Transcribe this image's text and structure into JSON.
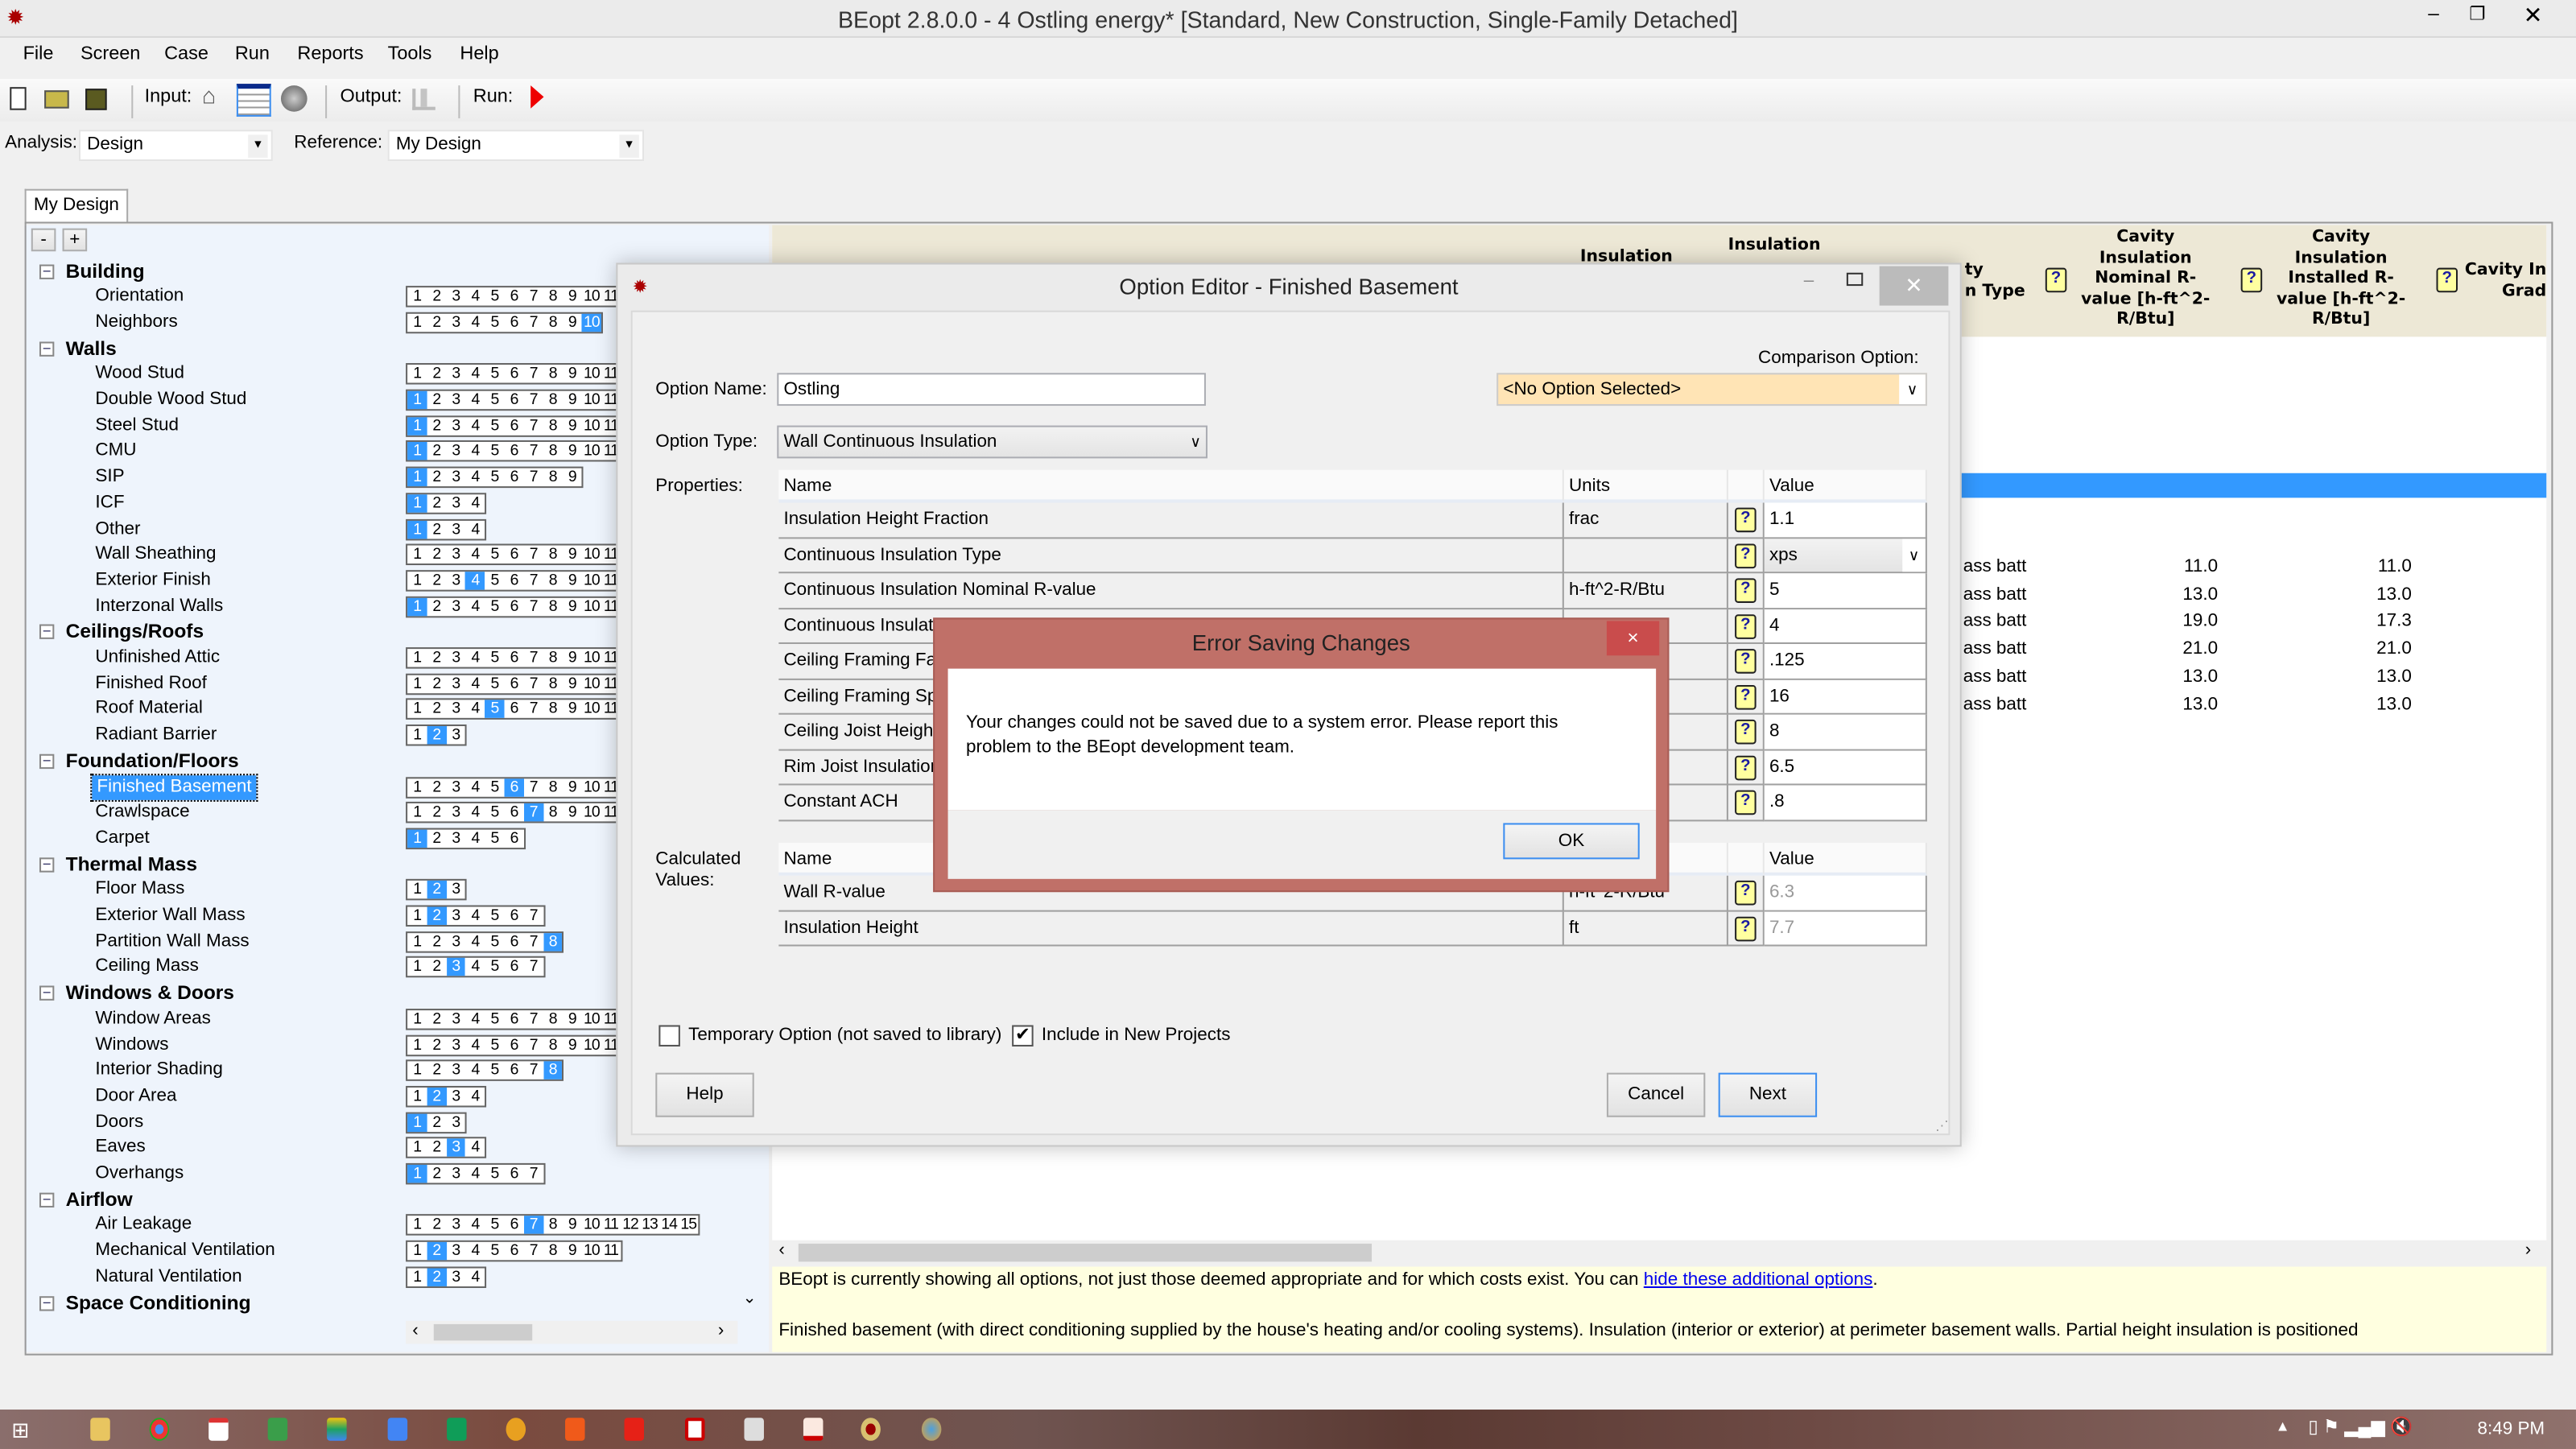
{
  "window": {
    "title": "BEopt 2.8.0.0 - 4 Ostling energy* [Standard, New Construction, Single-Family Detached]",
    "app_icon": "sun-icon"
  },
  "menu": [
    "File",
    "Screen",
    "Case",
    "Run",
    "Reports",
    "Tools",
    "Help"
  ],
  "toolbar": {
    "input_label": "Input:",
    "output_label": "Output:",
    "run_label": "Run:",
    "icons": [
      "new-file-icon",
      "open-folder-icon",
      "save-icon",
      "house-icon",
      "list-icon",
      "globe-icon",
      "chart-icon",
      "run-icon"
    ]
  },
  "analysis": {
    "label": "Analysis:",
    "value": "Design",
    "reference_label": "Reference:",
    "reference_value": "My Design"
  },
  "tab": "My Design",
  "tree": {
    "collapse_label": "-",
    "expand_label": "+",
    "sections": [
      {
        "name": "Building",
        "items": [
          {
            "name": "Orientation",
            "count": 11,
            "selected": null
          },
          {
            "name": "Neighbors",
            "count": 10,
            "selected": 10
          }
        ]
      },
      {
        "name": "Walls",
        "items": [
          {
            "name": "Wood Stud",
            "count": 11,
            "selected": null
          },
          {
            "name": "Double Wood Stud",
            "count": 11,
            "selected": 1
          },
          {
            "name": "Steel Stud",
            "count": 11,
            "selected": 1
          },
          {
            "name": "CMU",
            "count": 11,
            "selected": 1
          },
          {
            "name": "SIP",
            "count": 9,
            "selected": 1
          },
          {
            "name": "ICF",
            "count": 4,
            "selected": 1
          },
          {
            "name": "Other",
            "count": 4,
            "selected": 1
          },
          {
            "name": "Wall Sheathing",
            "count": 11,
            "selected": null
          },
          {
            "name": "Exterior Finish",
            "count": 11,
            "selected": 4
          },
          {
            "name": "Interzonal Walls",
            "count": 11,
            "selected": 1
          }
        ]
      },
      {
        "name": "Ceilings/Roofs",
        "items": [
          {
            "name": "Unfinished Attic",
            "count": 11,
            "selected": null
          },
          {
            "name": "Finished Roof",
            "count": 11,
            "selected": null
          },
          {
            "name": "Roof Material",
            "count": 11,
            "selected": 5
          },
          {
            "name": "Radiant Barrier",
            "count": 3,
            "selected": 2
          }
        ]
      },
      {
        "name": "Foundation/Floors",
        "items": [
          {
            "name": "Finished Basement",
            "count": 11,
            "selected": 6,
            "active": true
          },
          {
            "name": "Crawlspace",
            "count": 11,
            "selected": 7
          },
          {
            "name": "Carpet",
            "count": 6,
            "selected": 1
          }
        ]
      },
      {
        "name": "Thermal Mass",
        "items": [
          {
            "name": "Floor Mass",
            "count": 3,
            "selected": 2
          },
          {
            "name": "Exterior Wall Mass",
            "count": 7,
            "selected": 2
          },
          {
            "name": "Partition Wall Mass",
            "count": 8,
            "selected": 8
          },
          {
            "name": "Ceiling Mass",
            "count": 7,
            "selected": 3
          }
        ]
      },
      {
        "name": "Windows & Doors",
        "items": [
          {
            "name": "Window Areas",
            "count": 11,
            "selected": null
          },
          {
            "name": "Windows",
            "count": 11,
            "selected": null
          },
          {
            "name": "Interior Shading",
            "count": 8,
            "selected": 8
          },
          {
            "name": "Door Area",
            "count": 4,
            "selected": 2
          },
          {
            "name": "Doors",
            "count": 3,
            "selected": 1
          },
          {
            "name": "Eaves",
            "count": 4,
            "selected": 3
          },
          {
            "name": "Overhangs",
            "count": 7,
            "selected": 1
          }
        ]
      },
      {
        "name": "Airflow",
        "items": [
          {
            "name": "Air Leakage",
            "count": 15,
            "selected": 7
          },
          {
            "name": "Mechanical Ventilation",
            "count": 11,
            "selected": 2
          },
          {
            "name": "Natural Ventilation",
            "count": 4,
            "selected": 2
          }
        ]
      },
      {
        "name": "Space Conditioning",
        "items": []
      }
    ]
  },
  "grid": {
    "headers": {
      "insulation_a": "Insulation",
      "insulation_b": "Insulation",
      "type_line1": "ty",
      "type_line2": "n Type",
      "nominal": "Cavity Insulation Nominal R-value [h-ft^2-R/Btu]",
      "installed": "Cavity Insulation Installed R-value [h-ft^2-R/Btu]",
      "grade_line1": "Cavity In",
      "grade_line2": "Grad"
    },
    "selection_color": "#3399ff",
    "rows": [
      {
        "type": "ass batt",
        "nominal": "11.0",
        "installed": "11.0"
      },
      {
        "type": "ass batt",
        "nominal": "13.0",
        "installed": "13.0"
      },
      {
        "type": "ass batt",
        "nominal": "19.0",
        "installed": "17.3"
      },
      {
        "type": "ass batt",
        "nominal": "21.0",
        "installed": "21.0"
      },
      {
        "type": "ass batt",
        "nominal": "13.0",
        "installed": "13.0"
      },
      {
        "type": "ass batt",
        "nominal": "13.0",
        "installed": "13.0"
      }
    ]
  },
  "info": {
    "line1": "BEopt is currently showing all options, not just those deemed appropriate and for which costs exist.  You can ",
    "link": "hide these additional options",
    "line1_end": ".",
    "line2": "Finished basement (with direct conditioning supplied by the house's heating and/or cooling systems).  Insulation (interior or exterior) at perimeter basement walls.  Partial height insulation is positioned"
  },
  "editor": {
    "title": "Option Editor - Finished Basement",
    "option_name_label": "Option Name:",
    "option_name": "Ostling",
    "comparison_label": "Comparison Option:",
    "comparison_value": "<No Option Selected>",
    "comparison_color": "#ffe4b5",
    "option_type_label": "Option Type:",
    "option_type": "Wall Continuous Insulation",
    "properties_label": "Properties:",
    "columns": {
      "name": "Name",
      "units": "Units",
      "value": "Value"
    },
    "properties": [
      {
        "name": "Insulation Height Fraction",
        "units": "frac",
        "value": "1.1"
      },
      {
        "name": "Continuous Insulation Type",
        "units": "",
        "value": "xps",
        "dropdown": true
      },
      {
        "name": "Continuous Insulation Nominal R-value",
        "units": "h-ft^2-R/Btu",
        "value": "5"
      },
      {
        "name": "Continuous Insulatio",
        "units": "",
        "value": "4"
      },
      {
        "name": "Ceiling Framing Fact",
        "units": "",
        "value": ".125"
      },
      {
        "name": "Ceiling Framing Spa",
        "units": "",
        "value": "16"
      },
      {
        "name": "Ceiling Joist Height",
        "units": "",
        "value": "8"
      },
      {
        "name": "Rim Joist Insulation",
        "units": "",
        "value": "6.5"
      },
      {
        "name": "Constant ACH",
        "units": "",
        "value": ".8"
      }
    ],
    "calculated_label": "Calculated Values:",
    "calculated": [
      {
        "name": "Wall R-value",
        "units": "h-ft^2-R/Btu",
        "value": "6.3"
      },
      {
        "name": "Insulation Height",
        "units": "ft",
        "value": "7.7"
      }
    ],
    "temporary_label": "Temporary Option (not saved to library)",
    "temporary_checked": false,
    "include_label": "Include in New Projects",
    "include_checked": true,
    "help_button": "Help",
    "cancel_button": "Cancel",
    "next_button": "Next"
  },
  "error": {
    "title": "Error Saving Changes",
    "message": "Your changes could not be saved due to a system error.  Please report this problem to the BEopt development team.",
    "ok_button": "OK",
    "close_label": "×"
  },
  "taskbar": {
    "time": "8:49 PM"
  }
}
